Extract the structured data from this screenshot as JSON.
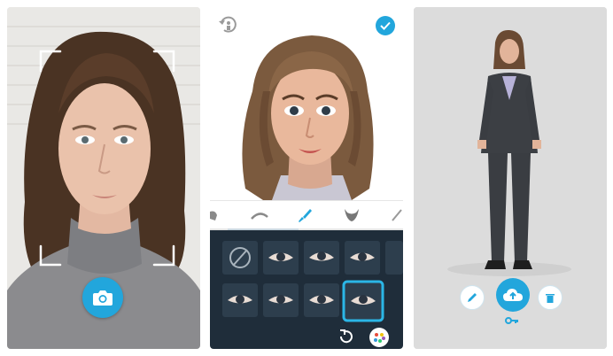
{
  "colors": {
    "accent": "#22a6dc",
    "editor_bg": "#1f2d3a",
    "selection": "#2bb6e6"
  },
  "capture_panel": {
    "capture_icon": "camera-icon"
  },
  "editor_panel": {
    "undo_icon": "undo-avatar-icon",
    "confirm_icon": "check-icon",
    "tabs": [
      {
        "icon": "hair-icon",
        "active": false
      },
      {
        "icon": "eyebrow-icon",
        "active": false
      },
      {
        "icon": "makeup-brush-icon",
        "active": true
      },
      {
        "icon": "beard-icon",
        "active": false
      },
      {
        "icon": "pencil-icon",
        "active": false
      }
    ],
    "eye_options": [
      {
        "icon": "none-icon",
        "selected": false
      },
      {
        "icon": "eye-style-1-icon",
        "selected": false
      },
      {
        "icon": "eye-style-2-icon",
        "selected": false
      },
      {
        "icon": "eye-style-3-icon",
        "selected": false
      },
      {
        "icon": "eye-style-4-icon",
        "selected": false
      },
      {
        "icon": "eye-style-5-icon",
        "selected": false
      },
      {
        "icon": "eye-style-6-icon",
        "selected": false
      },
      {
        "icon": "eye-style-7-icon",
        "selected": true
      }
    ],
    "reset_icon": "reset-icon",
    "palette_icon": "color-palette-icon"
  },
  "preview_panel": {
    "edit_icon": "pencil-icon",
    "upload_icon": "cloud-upload-icon",
    "delete_icon": "trash-icon",
    "key_icon": "key-icon"
  }
}
